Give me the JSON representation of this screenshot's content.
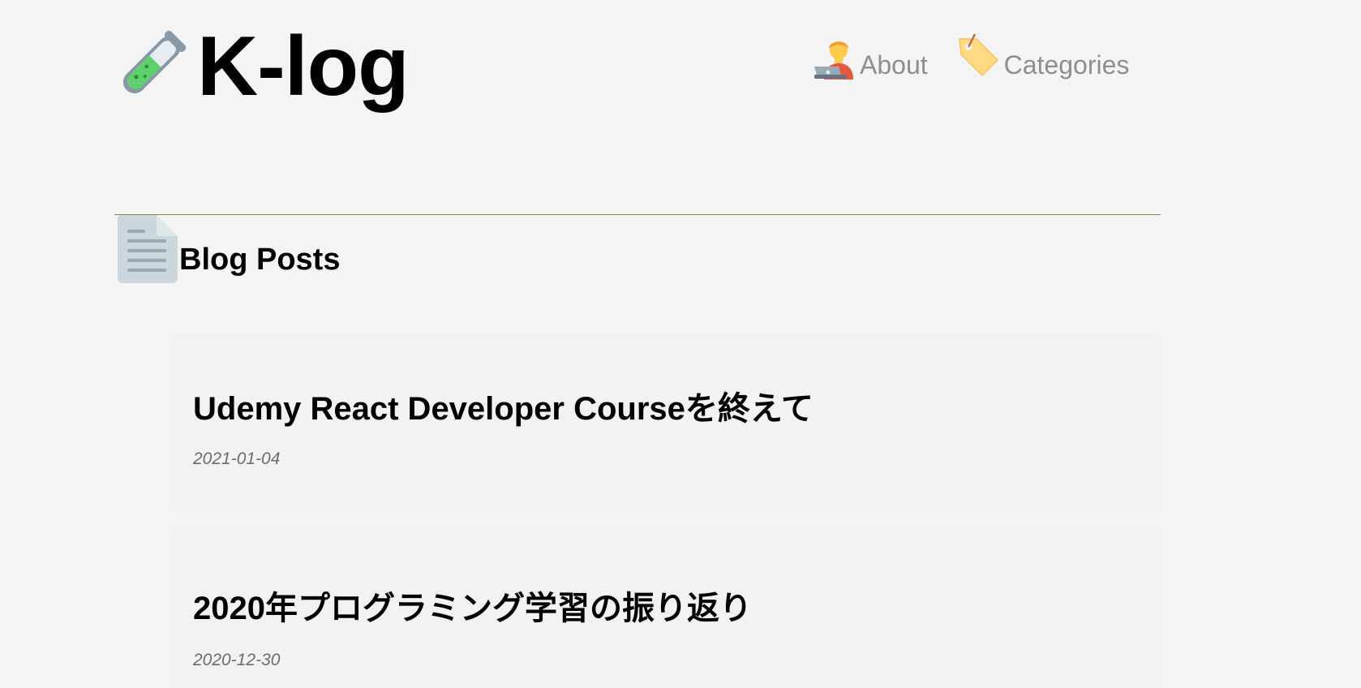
{
  "header": {
    "title": "K-log",
    "logo_icon": "test-tube-icon",
    "nav": [
      {
        "label": "About",
        "icon": "technologist-icon"
      },
      {
        "label": "Categories",
        "icon": "label-tag-icon"
      }
    ]
  },
  "main": {
    "section_title": "Blog Posts",
    "section_icon": "page-document-icon",
    "posts": [
      {
        "title": "Udemy React Developer Courseを終えて",
        "date": "2021-01-04"
      },
      {
        "title": "2020年プログラミング学習の振り返り",
        "date": "2020-12-30"
      }
    ]
  },
  "colors": {
    "background": "#f3f4f3",
    "card_background": "#f2f2f2",
    "nav_text": "#8e8e8e",
    "divider": "#8c8c3a",
    "date_text": "#6c6c6c"
  }
}
